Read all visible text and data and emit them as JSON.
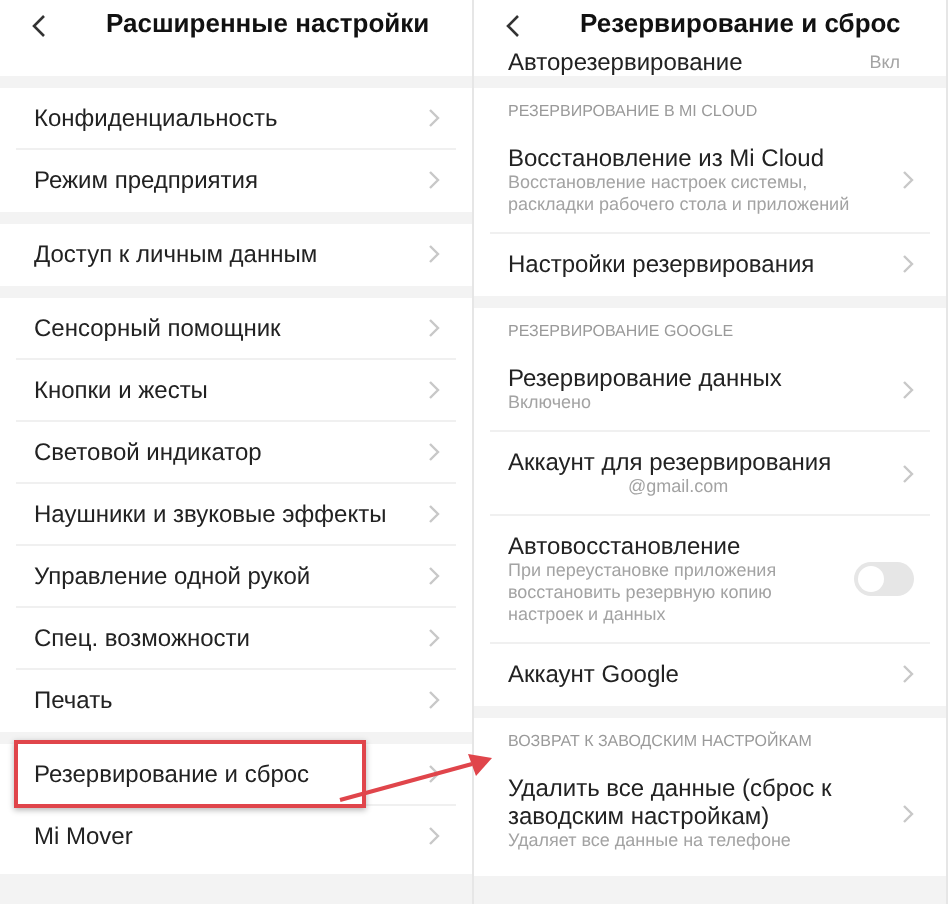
{
  "screens": [
    {
      "title": "Расширенные настройки",
      "sections": [
        {
          "items": [
            {
              "kind": "link",
              "title": "Конфиденциальность",
              "highlighted": false
            },
            {
              "kind": "link",
              "title": "Режим предприятия",
              "highlighted": false
            }
          ]
        },
        {
          "items": [
            {
              "kind": "link",
              "title": "Доступ к личным данным",
              "highlighted": false
            }
          ]
        },
        {
          "items": [
            {
              "kind": "link",
              "title": "Сенсорный помощник",
              "highlighted": false
            },
            {
              "kind": "link",
              "title": "Кнопки и жесты",
              "highlighted": false
            },
            {
              "kind": "link",
              "title": "Световой индикатор",
              "highlighted": false
            },
            {
              "kind": "link",
              "title": "Наушники и звуковые эффекты",
              "highlighted": false
            },
            {
              "kind": "link",
              "title": "Управление одной рукой",
              "highlighted": false
            },
            {
              "kind": "link",
              "title": "Спец. возможности",
              "highlighted": false
            },
            {
              "kind": "link",
              "title": "Печать",
              "highlighted": false
            }
          ]
        },
        {
          "items": [
            {
              "kind": "link",
              "title": "Резервирование и сброс",
              "highlighted": true
            },
            {
              "kind": "link",
              "title": "Mi Mover",
              "highlighted": false
            }
          ]
        }
      ]
    },
    {
      "title": "Резервирование и сброс",
      "top_cut": {
        "title": "Авторезервирование",
        "value": "Вкл"
      },
      "sections": [
        {
          "header": "РЕЗЕРВИРОВАНИЕ В MI CLOUD",
          "items": [
            {
              "kind": "link",
              "title": "Восстановление из Mi Cloud",
              "subtitle": "Восстановление настроек системы, раскладки рабочего стола и приложений",
              "highlighted": false
            },
            {
              "kind": "link",
              "title": "Настройки резервирования",
              "highlighted": false
            }
          ]
        },
        {
          "header": "РЕЗЕРВИРОВАНИЕ GOOGLE",
          "items": [
            {
              "kind": "link",
              "title": "Резервирование данных",
              "subtitle": "Включено",
              "highlighted": false
            },
            {
              "kind": "account",
              "title": "Аккаунт для резервирования",
              "subtitle": "@gmail.com",
              "highlighted": false
            },
            {
              "kind": "toggle",
              "title": "Автовосстановление",
              "subtitle": "При переустановке приложения восстановить резервную копию настроек и данных",
              "on": false,
              "highlighted": false
            },
            {
              "kind": "link",
              "title": "Аккаунт Google",
              "highlighted": false
            }
          ]
        },
        {
          "header": "ВОЗВРАТ К ЗАВОДСКИМ НАСТРОЙКАМ",
          "items": [
            {
              "kind": "link",
              "title": "Удалить все данные (сброс к заводским настройкам)",
              "subtitle": "Удаляет все данные на телефоне",
              "highlighted": false
            }
          ]
        }
      ]
    }
  ],
  "annotation_arrow": true
}
